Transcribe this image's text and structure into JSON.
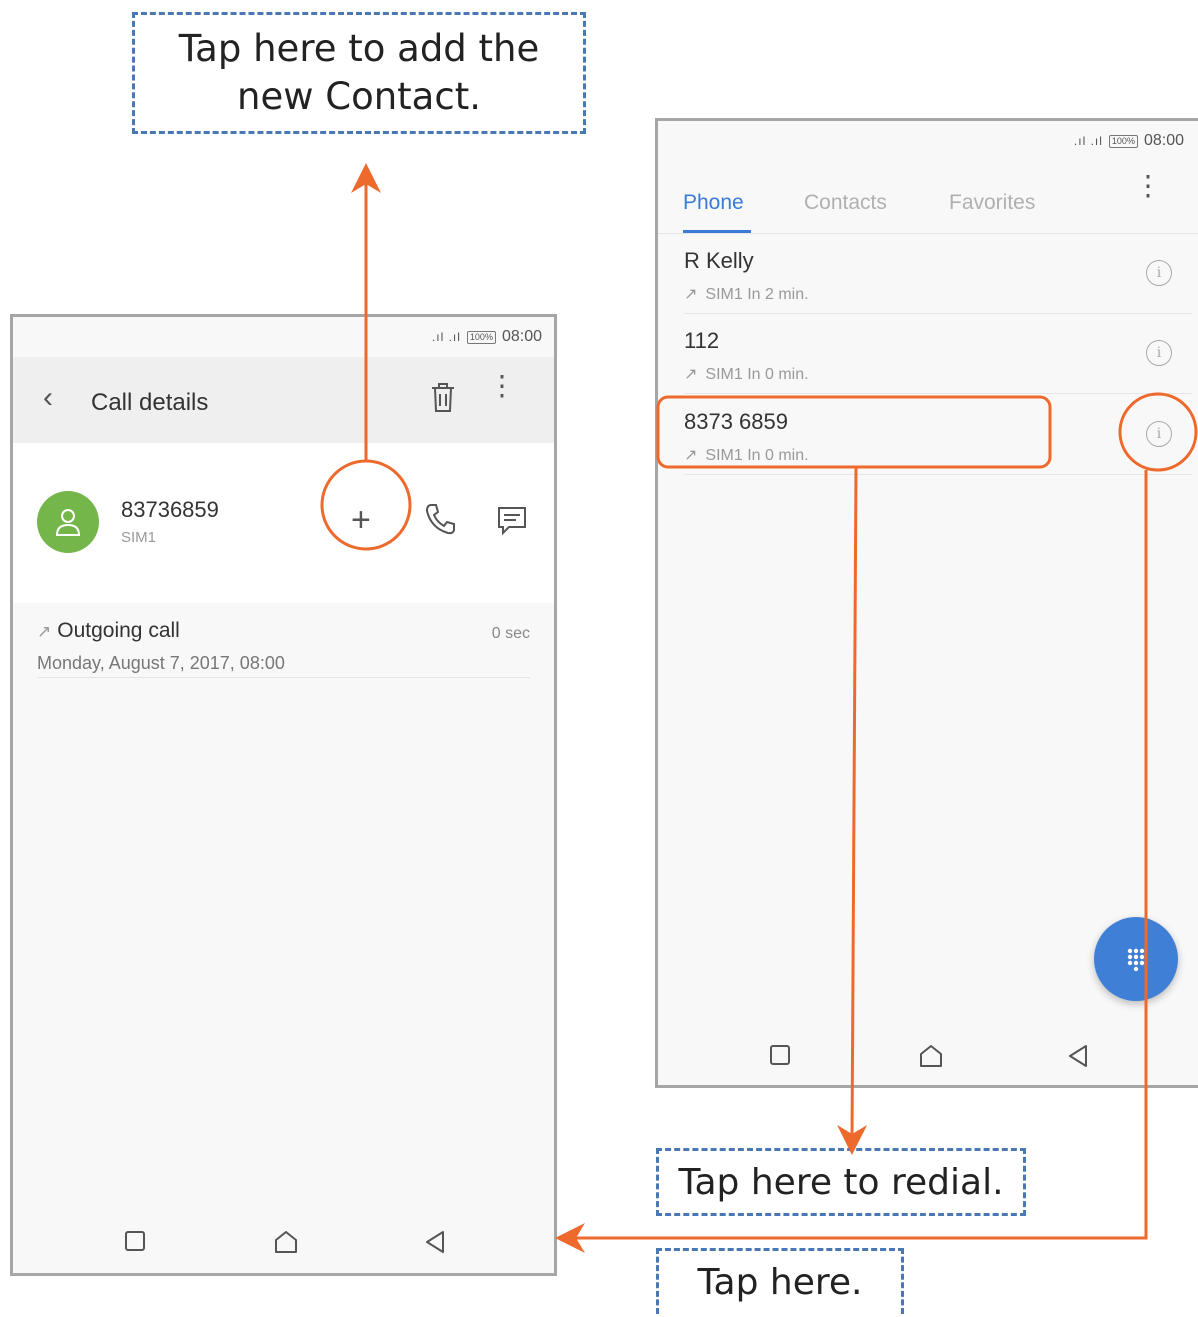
{
  "callouts": {
    "add_contact_line1": "Tap here to add the",
    "add_contact_line2": "new Contact.",
    "redial": "Tap here to redial.",
    "tap_here": "Tap here."
  },
  "status_bar": {
    "signal": ".ıl .ıl",
    "battery": "100%",
    "time": "08:00"
  },
  "call_details": {
    "back_icon": "chevron-left-icon",
    "title": "Call details",
    "contact_number": "83736859",
    "sim": "SIM1",
    "call_entry": {
      "type": "Outgoing call",
      "datetime": "Monday, August 7, 2017, 08:00",
      "duration": "0 sec"
    }
  },
  "phone_log": {
    "tabs": [
      "Phone",
      "Contacts",
      "Favorites"
    ],
    "active_tab": "Phone",
    "entries": [
      {
        "name": "R Kelly",
        "meta": "SIM1  In 2 min."
      },
      {
        "name": "112",
        "meta": "SIM1  In 0 min."
      },
      {
        "name": "8373 6859",
        "meta": "SIM1  In 0 min."
      }
    ]
  },
  "colors": {
    "accent_blue": "#3a7bd5",
    "annotation_orange": "#ee6a2c",
    "callout_border": "#4a78b5",
    "avatar_green": "#75b64b"
  }
}
